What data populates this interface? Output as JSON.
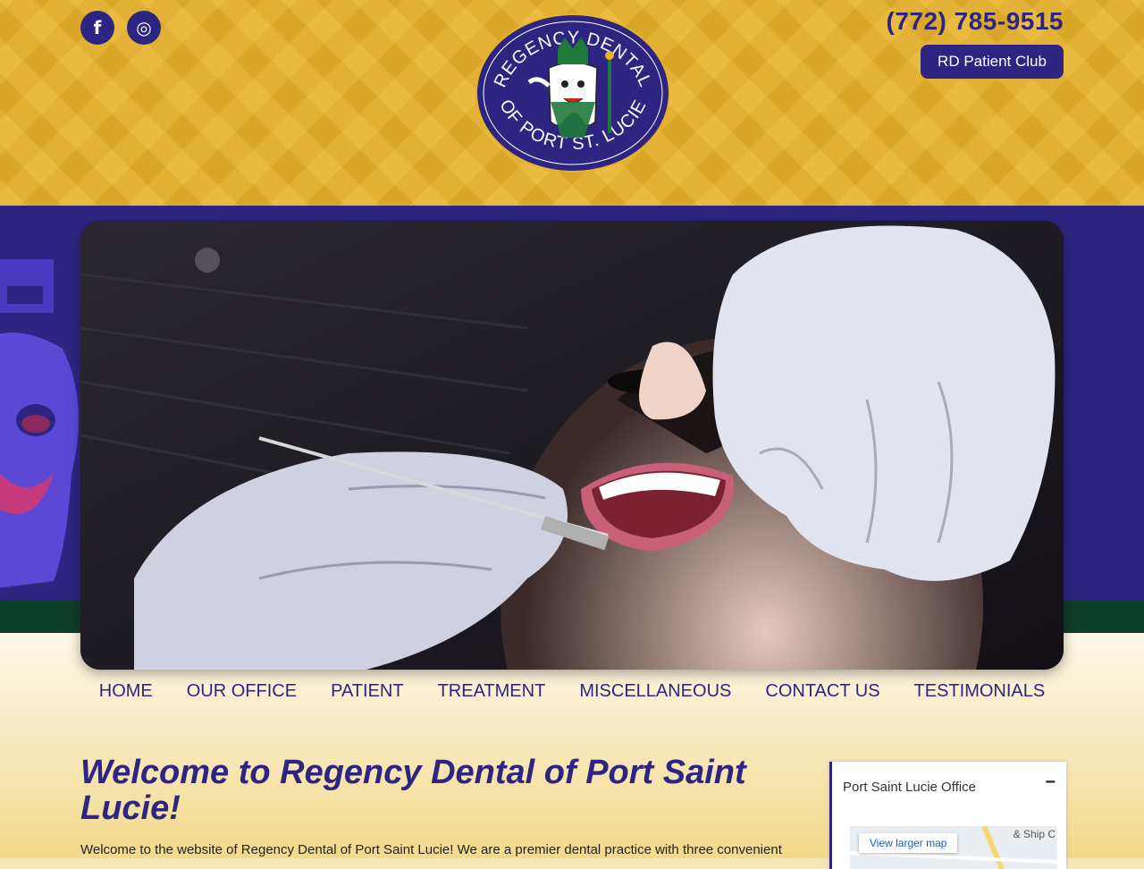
{
  "header": {
    "social": [
      {
        "name": "facebook-icon",
        "glyph": "f"
      },
      {
        "name": "instagram-icon",
        "glyph": "◎"
      }
    ],
    "phone": "(772) 785-9515",
    "club_button": "RD Patient Club",
    "logo": {
      "top_text": "REGENCY DENTAL",
      "bottom_text": "OF PORT ST. LUCIE"
    }
  },
  "colors": {
    "brand_purple": "#2e2582",
    "brand_gold": "#e8b22a",
    "brand_green": "#0e3f2a"
  },
  "nav": {
    "items": [
      "HOME",
      "OUR OFFICE",
      "PATIENT",
      "TREATMENT",
      "MISCELLANEOUS",
      "CONTACT US",
      "TESTIMONIALS"
    ]
  },
  "main": {
    "title": "Welcome to Regency Dental of Port Saint Lucie!",
    "intro": "Welcome to the website of Regency Dental of Port Saint Lucie! We are a premier dental practice with three convenient"
  },
  "sidebar": {
    "title": "Port Saint Lucie Office",
    "collapse_glyph": "−",
    "map_link": "View larger map",
    "map_label": "& Ship C"
  }
}
